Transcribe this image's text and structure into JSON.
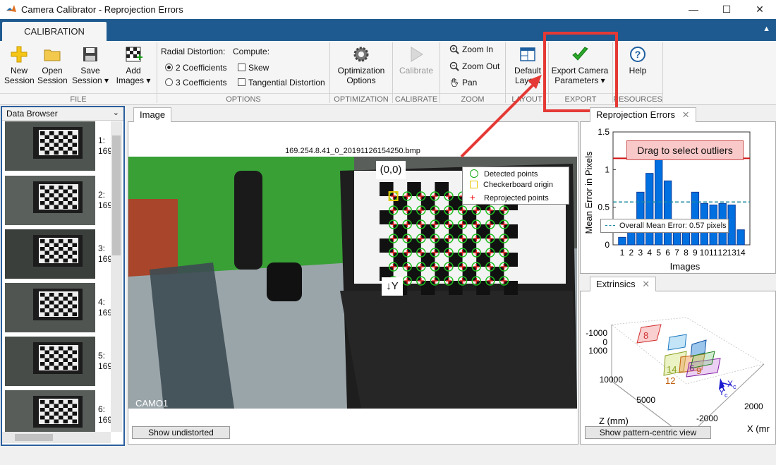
{
  "window": {
    "title": "Camera Calibrator - Reprojection Errors",
    "minimize": "—",
    "maximize": "☐",
    "close": "✕"
  },
  "ribbon_tab": "CALIBRATION",
  "file": {
    "new_session": [
      "New",
      "Session"
    ],
    "open_session": [
      "Open",
      "Session"
    ],
    "save_session": [
      "Save",
      "Session ▾"
    ],
    "add_images": [
      "Add",
      "Images ▾"
    ],
    "section": "FILE"
  },
  "options": {
    "radial_label": "Radial Distortion:",
    "radial_opt1": "2 Coefficients",
    "radial_opt2": "3 Coefficients",
    "compute_label": "Compute:",
    "skew": "Skew",
    "tangential": "Tangential Distortion",
    "section": "OPTIONS"
  },
  "optimization": {
    "label": [
      "Optimization",
      "Options"
    ],
    "section": "OPTIMIZATION"
  },
  "calibrate": {
    "label": "Calibrate",
    "section": "CALIBRATE"
  },
  "zoom": {
    "zoom_in": "Zoom In",
    "zoom_out": "Zoom Out",
    "pan": "Pan",
    "section": "ZOOM"
  },
  "layout": {
    "label": [
      "Default",
      "Layout"
    ],
    "section": "LAYOUT"
  },
  "export": {
    "label": [
      "Export Camera",
      "Parameters ▾"
    ],
    "section": "EXPORT"
  },
  "resources": {
    "label": "Help",
    "section": "RESOURCES"
  },
  "data_browser": {
    "title": "Data Browser",
    "items": [
      {
        "index": "1:",
        "name": "169"
      },
      {
        "index": "2:",
        "name": "169"
      },
      {
        "index": "3:",
        "name": "169"
      },
      {
        "index": "4:",
        "name": "169"
      },
      {
        "index": "5:",
        "name": "169"
      },
      {
        "index": "6:",
        "name": "169"
      }
    ]
  },
  "image_panel": {
    "tab": "Image",
    "filename": "169.254.8.41_0_20191126154250.bmp",
    "origin_label": "(0,0)",
    "y_label": "↓Y",
    "camera_label": "CAMO1",
    "legend": [
      "Detected points",
      "Checkerboard origin",
      "Reprojected points"
    ],
    "show_undistorted": "Show undistorted"
  },
  "reproj_panel": {
    "tab": "Reprojection Errors",
    "close": "✕"
  },
  "extrinsics_panel": {
    "tab": "Extrinsics",
    "close": "✕",
    "y_ticks": [
      "-1000",
      "0",
      "1000"
    ],
    "z_ticks": [
      "10000",
      "5000"
    ],
    "x_ticks": [
      "2000",
      "-2000"
    ],
    "z_label": "Z (mm)",
    "x_label": "X (mr",
    "plane_labels": [
      "8",
      "14",
      "12",
      "9",
      "6"
    ],
    "axis_xc": "X",
    "axis_yc": "Y",
    "axis_sub": "c",
    "button": "Show pattern-centric view"
  },
  "colors": {
    "accent": "#1e5a8f",
    "bar": "#0070e0",
    "highlight": "#e53935"
  },
  "chart_data": {
    "type": "bar",
    "title": "",
    "xlabel": "Images",
    "ylabel": "Mean Error in Pixels",
    "categories": [
      "1",
      "2",
      "3",
      "4",
      "5",
      "6",
      "7",
      "8",
      "9",
      "10",
      "11",
      "12",
      "13",
      "14"
    ],
    "values": [
      0.1,
      0.22,
      0.7,
      0.95,
      1.13,
      0.85,
      0.3,
      0.22,
      0.7,
      0.55,
      0.53,
      0.55,
      0.53,
      0.2
    ],
    "ylim": [
      0,
      1.5
    ],
    "yticks": [
      0,
      0.5,
      1,
      1.5
    ],
    "mean_value": 0.57,
    "mean_label": "Overall Mean Error: 0.57 pixels",
    "outlier_threshold": 1.15,
    "outlier_button": "Drag to select outliers"
  }
}
